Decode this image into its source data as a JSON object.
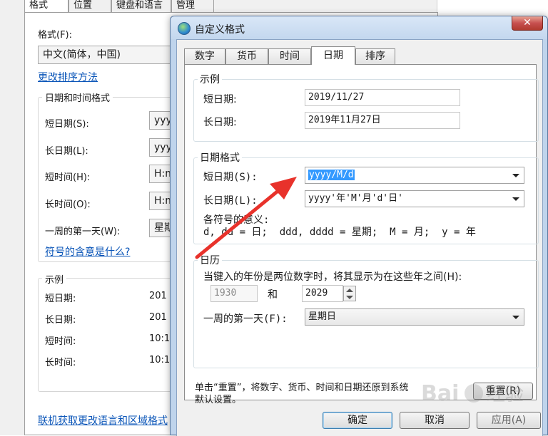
{
  "background_window": {
    "tabs": [
      "格式",
      "位置",
      "键盘和语言",
      "管理"
    ],
    "format_label": "格式(F):",
    "format_value": "中文(简体，中国)",
    "sort_link": "更改排序方法",
    "datetime_group_title": "日期和时间格式",
    "rows": [
      {
        "label": "短日期(S):",
        "value": "yyy"
      },
      {
        "label": "长日期(L):",
        "value": "yyy"
      },
      {
        "label": "短时间(H):",
        "value": "H:m"
      },
      {
        "label": "长时间(O):",
        "value": "H:m"
      },
      {
        "label": "一周的第一天(W):",
        "value": "星期"
      }
    ],
    "symbols_link": "符号的含意是什么?",
    "example_group_title": "示例",
    "examples": [
      {
        "label": "短日期:",
        "value": "201"
      },
      {
        "label": "长日期:",
        "value": "201"
      },
      {
        "label": "短时间:",
        "value": "10:1"
      },
      {
        "label": "长时间:",
        "value": "10:1"
      }
    ],
    "online_link": "联机获取更改语言和区域格式"
  },
  "dialog": {
    "title": "自定义格式",
    "close_glyph": "✕",
    "tabs": [
      "数字",
      "货币",
      "时间",
      "日期",
      "排序"
    ],
    "active_tab": "日期",
    "example_group": {
      "title": "示例",
      "short_label": "短日期:",
      "short_value": "2019/11/27",
      "long_label": "长日期:",
      "long_value": "2019年11月27日"
    },
    "format_group": {
      "title": "日期格式",
      "short_label": "短日期(S):",
      "short_value": "yyyy/M/d",
      "long_label": "长日期(L):",
      "long_value": "yyyy'年'M'月'd'日'",
      "symbols_title": "各符号的意义:",
      "symbols_text": "d, dd = 日;  ddd, dddd = 星期;  M = 月;  y = 年"
    },
    "calendar_group": {
      "title": "日历",
      "twodigit_text": "当键入的年份是两位数字时，将其显示为在这些年之间(H):",
      "year_from": "1930",
      "and_label": "和",
      "year_to": "2029",
      "firstday_label": "一周的第一天(F):",
      "firstday_value": "星期日"
    },
    "reset_text_line1": "单击“重置”，将数字、货币、时间和日期还原到系统",
    "reset_text_line2": "默认设置。",
    "reset_button": "重置(R)",
    "ok_button": "确定",
    "cancel_button": "取消",
    "apply_button": "应用(A)"
  },
  "accent_color": "#e8322b",
  "selection_color": "#3399ff"
}
